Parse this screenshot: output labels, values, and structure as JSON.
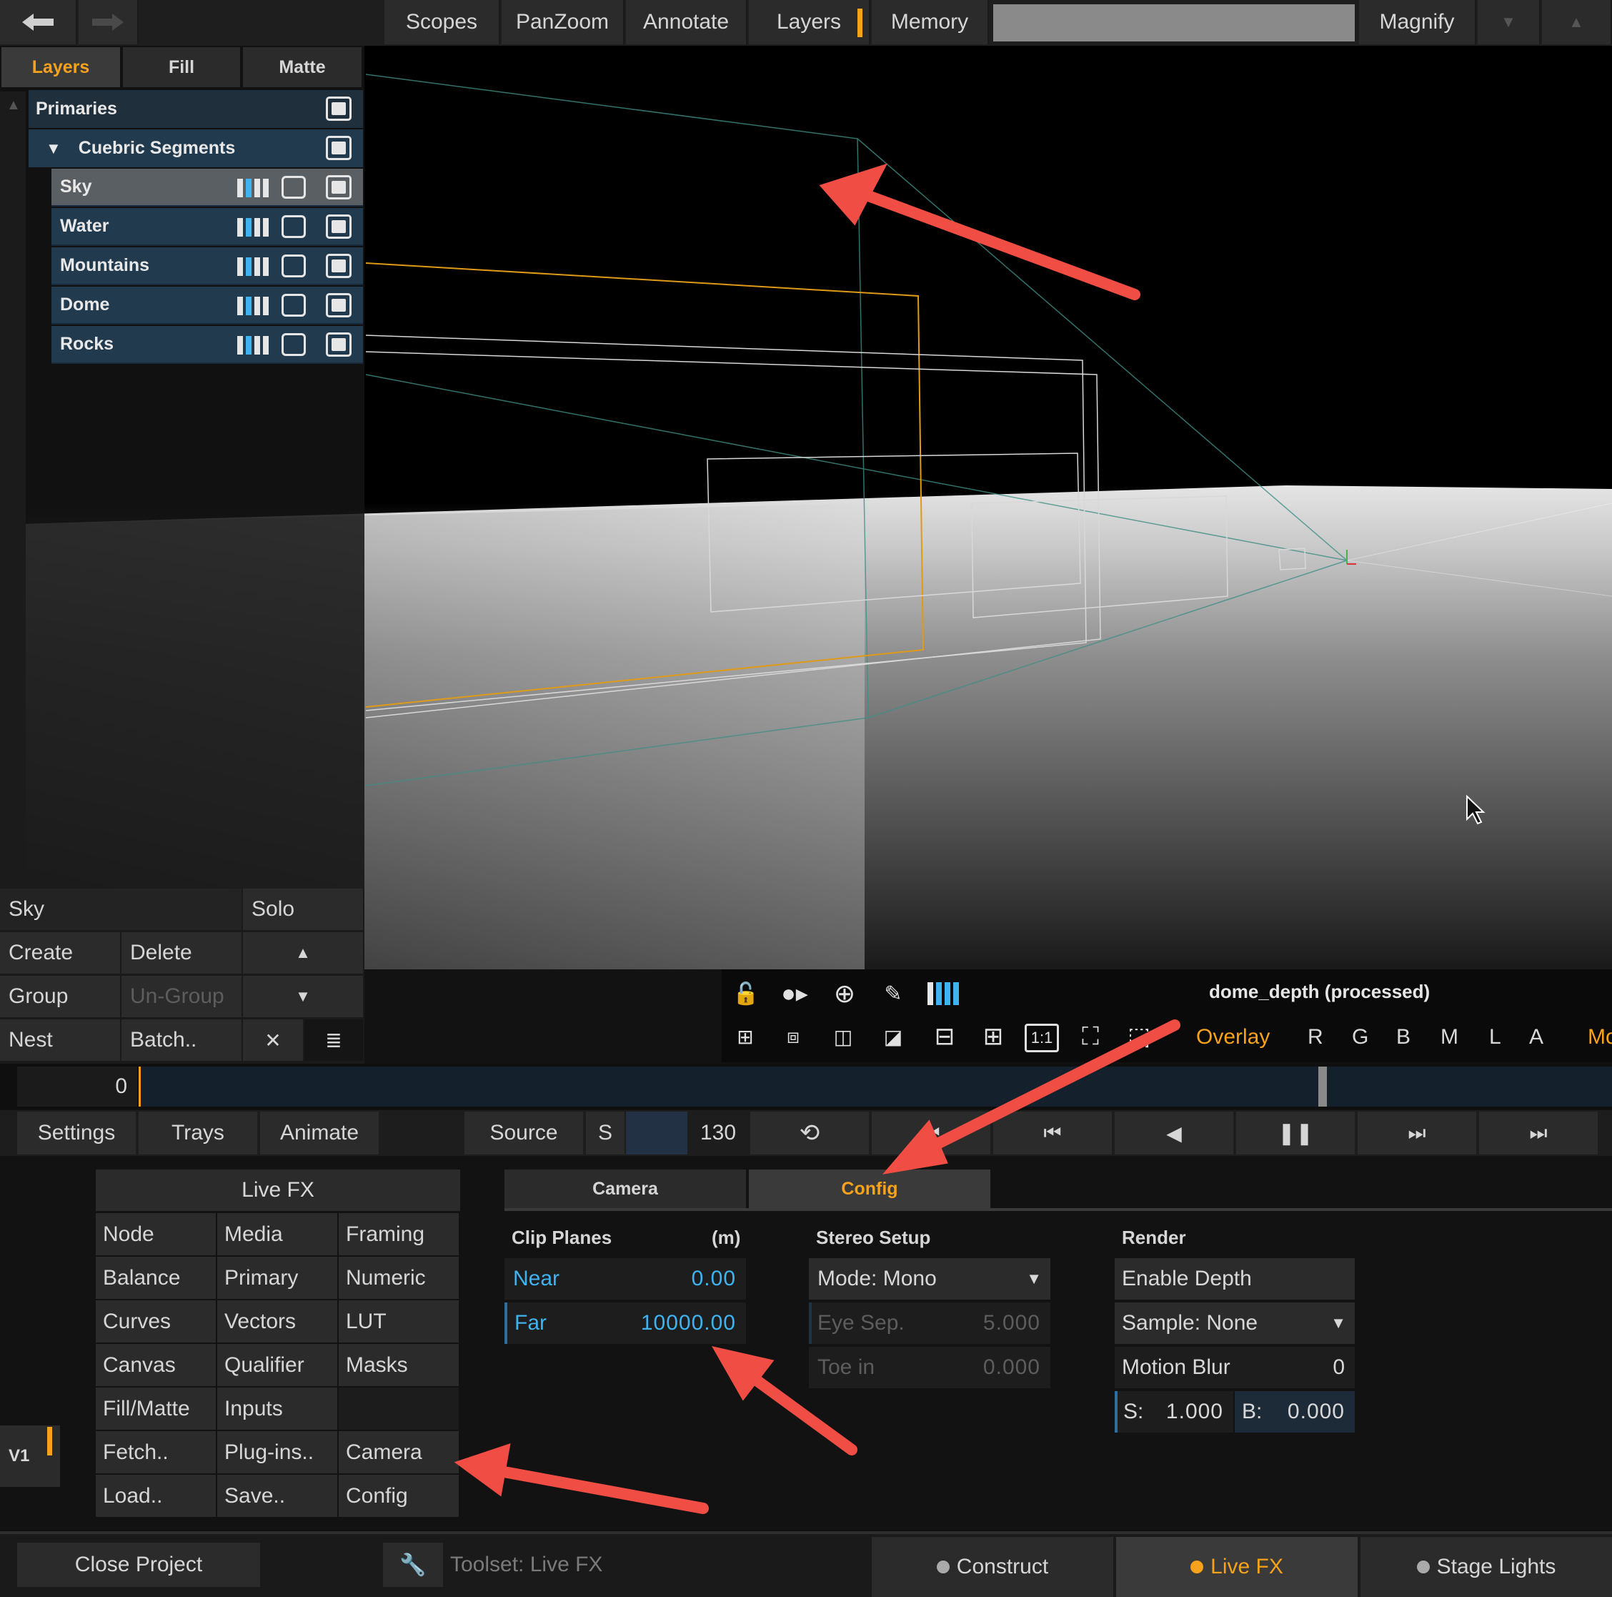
{
  "top_toolbar": {
    "back_icon": "arrow-left-icon",
    "forward_icon": "arrow-right-icon",
    "buttons": [
      "Scopes",
      "PanZoom",
      "Annotate",
      "Layers",
      "Memory"
    ],
    "magnify": "Magnify",
    "accent": "#f7a21b"
  },
  "layers_panel": {
    "tabs": [
      "Layers",
      "Fill",
      "Matte"
    ],
    "primaries": "Primaries",
    "group": "Cuebric Segments",
    "rows": [
      "Sky",
      "Water",
      "Mountains",
      "Dome",
      "Rocks"
    ],
    "selected_name": "Sky",
    "solo": "Solo",
    "create": "Create",
    "delete": "Delete",
    "group_btn": "Group",
    "ungroup": "Un-Group",
    "nest": "Nest",
    "batch": "Batch..",
    "close_symbol": "✕"
  },
  "viewer": {
    "clip_name": "dome_depth (processed)",
    "overlay": "Overlay",
    "channels": [
      "R",
      "G",
      "B",
      "M",
      "L",
      "A"
    ],
    "truncated_label": "Mo",
    "zoom_one": "1:1"
  },
  "timeline": {
    "start_frame": "0",
    "playhead_fraction": 0.805
  },
  "transport": {
    "settings": "Settings",
    "trays": "Trays",
    "animate": "Animate",
    "source": "Source",
    "s": "S",
    "frame": "130"
  },
  "livefx_menu": {
    "title": "Live FX",
    "cells": [
      [
        "Node",
        "Media",
        "Framing"
      ],
      [
        "Balance",
        "Primary",
        "Numeric"
      ],
      [
        "Curves",
        "Vectors",
        "LUT"
      ],
      [
        "Canvas",
        "Qualifier",
        "Masks"
      ],
      [
        "Fill/Matte",
        "Inputs",
        ""
      ],
      [
        "Fetch..",
        "Plug-ins..",
        "Camera"
      ],
      [
        "Load..",
        "Save..",
        "Config"
      ]
    ],
    "v1": "V1"
  },
  "camera_config": {
    "tabs": [
      "Camera",
      "Config"
    ],
    "clip_planes": {
      "title": "Clip Planes",
      "unit": "(m)",
      "near_label": "Near",
      "near_value": "0.00",
      "far_label": "Far",
      "far_value": "10000.00"
    },
    "stereo": {
      "title": "Stereo Setup",
      "mode": "Mode: Mono",
      "eye_sep_label": "Eye Sep.",
      "eye_sep_value": "5.000",
      "toe_in_label": "Toe in",
      "toe_in_value": "0.000"
    },
    "render": {
      "title": "Render",
      "enable_depth": "Enable Depth",
      "sample": "Sample: None",
      "motion_blur_label": "Motion Blur",
      "motion_blur_value": "0",
      "s_label": "S:",
      "s_value": "1.000",
      "b_label": "B:",
      "b_value": "0.000"
    }
  },
  "footer": {
    "close_project": "Close Project",
    "toolset": "Toolset: Live FX",
    "modes": [
      "Construct",
      "Live FX",
      "Stage Lights"
    ]
  }
}
